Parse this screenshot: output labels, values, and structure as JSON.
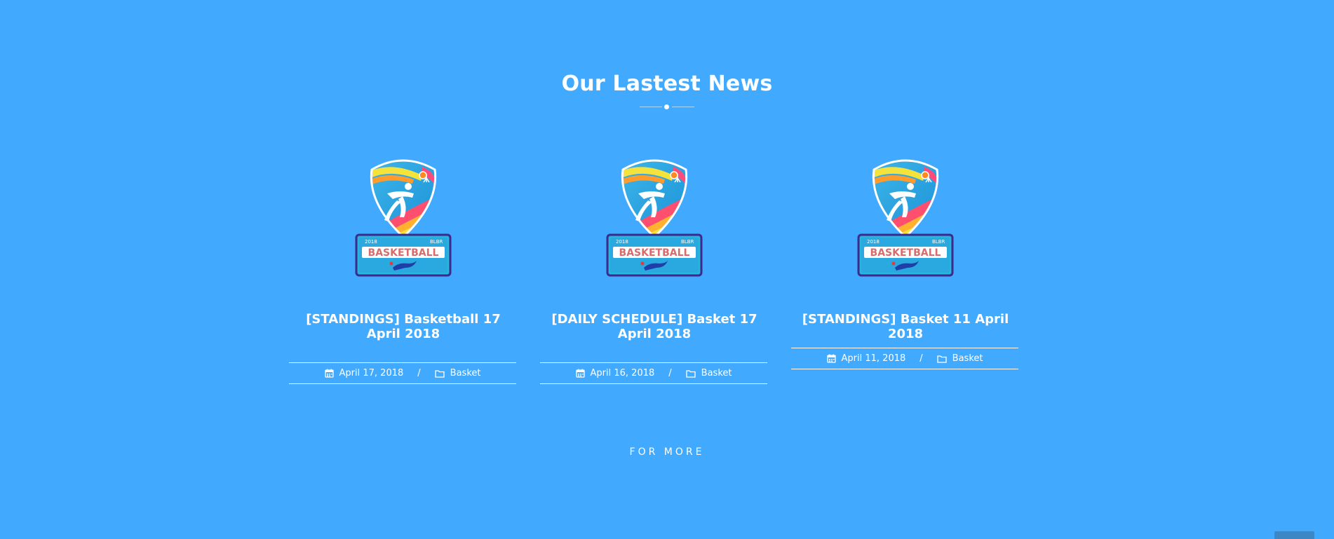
{
  "section": {
    "title": "Our Lastest News",
    "more_label": "FOR MORE"
  },
  "posts": [
    {
      "title": "[STANDINGS] Basketball 17 April 2018",
      "date": "April 17, 2018",
      "category": "Basket",
      "image": {
        "year": "2018",
        "code": "BLBR",
        "word": "BASKETBALL"
      }
    },
    {
      "title": "[DAILY SCHEDULE] Basket 17 April 2018",
      "date": "April 16, 2018",
      "category": "Basket",
      "image": {
        "year": "2018",
        "code": "BLBR",
        "word": "BASKETBALL"
      }
    },
    {
      "title": "[STANDINGS] Basket 11 April 2018",
      "date": "April 11, 2018",
      "category": "Basket",
      "image": {
        "year": "2018",
        "code": "BLBR",
        "word": "BASKETBALL"
      }
    }
  ],
  "meta_separator": "/",
  "icons": {
    "date": "calendar-icon",
    "category": "folder-icon",
    "scroll": "scroll-to-top-icon"
  },
  "colors": {
    "background": "#41aaff",
    "text": "#ffffff",
    "scroll_button": "#3d88c4"
  }
}
